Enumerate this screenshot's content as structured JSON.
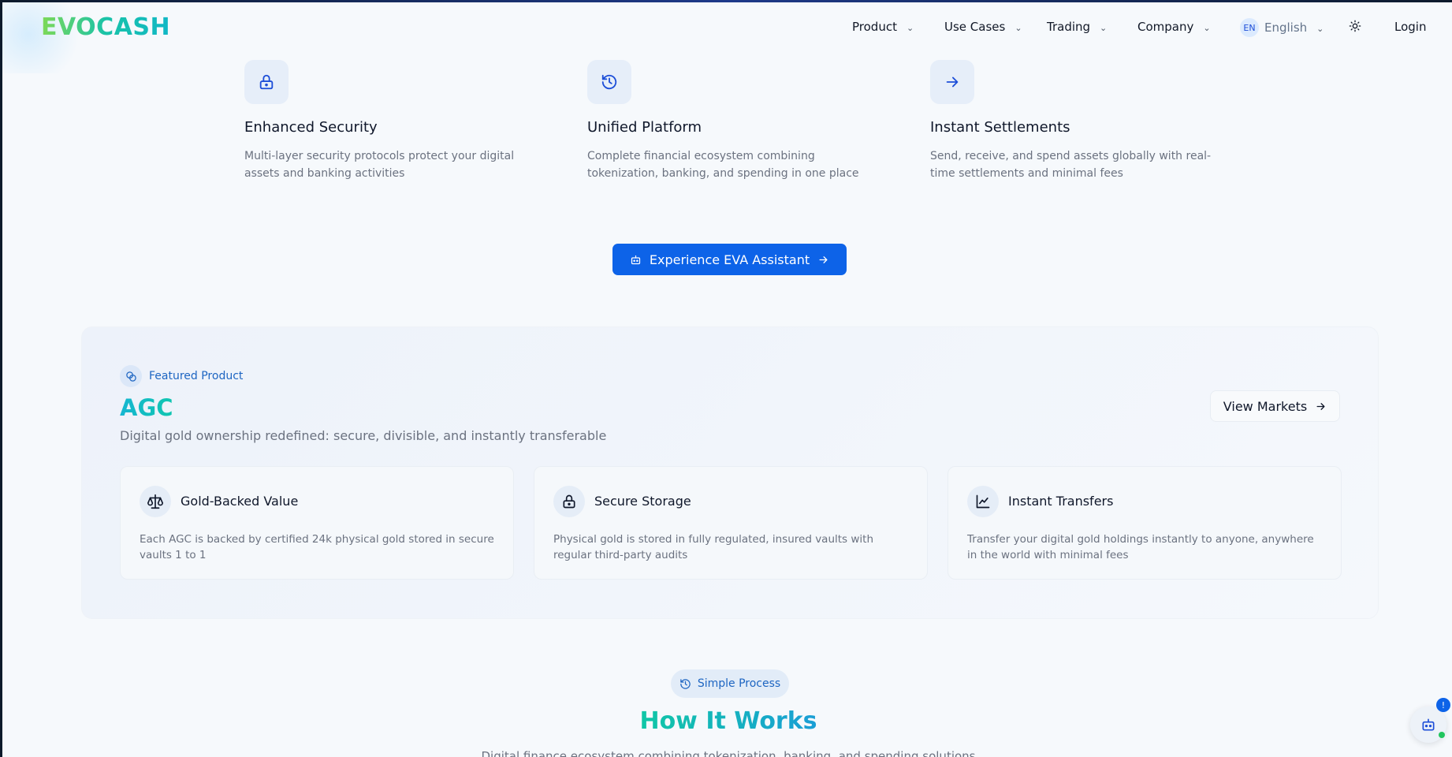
{
  "header": {
    "logo": "EVOCASH",
    "nav": [
      {
        "label": "Product"
      },
      {
        "label": "Use Cases"
      },
      {
        "label": "Trading"
      },
      {
        "label": "Company"
      }
    ],
    "language": {
      "code": "EN",
      "label": "English"
    },
    "theme_icon": "sun-icon",
    "login_label": "Login"
  },
  "features": [
    {
      "icon": "lock-icon",
      "title": "Enhanced Security",
      "description": "Multi-layer security protocols protect your digital assets and banking activities"
    },
    {
      "icon": "history-icon",
      "title": "Unified Platform",
      "description": "Complete financial ecosystem combining tokenization, banking, and spending in one place"
    },
    {
      "icon": "arrow-right-icon",
      "title": "Instant Settlements",
      "description": "Send, receive, and spend assets globally with real-time settlements and minimal fees"
    }
  ],
  "cta": {
    "label": "Experience EVA Assistant"
  },
  "featured": {
    "tag": "Featured Product",
    "title": "AGC",
    "description": "Digital gold ownership redefined: secure, divisible, and instantly transferable",
    "view_markets_label": "View Markets",
    "cards": [
      {
        "icon": "scale-icon",
        "title": "Gold-Backed Value",
        "description": "Each AGC is backed by certified 24k physical gold stored in secure vaults 1 to 1"
      },
      {
        "icon": "lock-icon",
        "title": "Secure Storage",
        "description": "Physical gold is stored in fully regulated, insured vaults with regular third-party audits"
      },
      {
        "icon": "chart-line-icon",
        "title": "Instant Transfers",
        "description": "Transfer your digital gold holdings instantly to anyone, anywhere in the world with minimal fees"
      }
    ]
  },
  "how_it_works": {
    "tag": "Simple Process",
    "title": "How It Works",
    "subtitle": "Digital finance ecosystem combining tokenization, banking, and spending solutions"
  },
  "assistant": {
    "badge": "!"
  },
  "colors": {
    "accent": "#0d63e8",
    "brand_green": "#19c3a8",
    "icon_blue": "#1d4ed8"
  }
}
